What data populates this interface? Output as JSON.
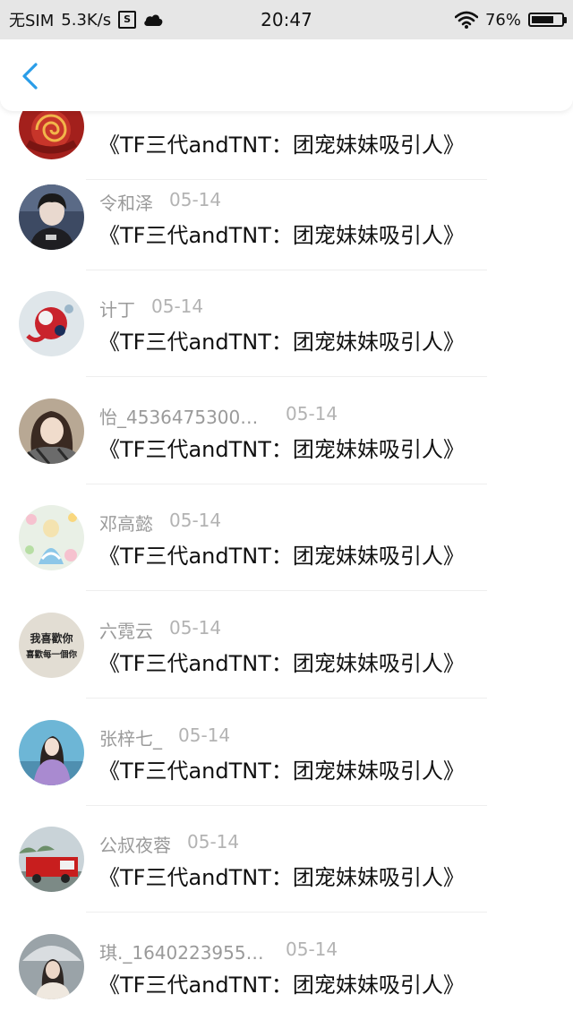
{
  "status_bar": {
    "carrier": "无SIM",
    "speed": "5.3K/s",
    "box_icon_glyph": "S",
    "time": "20:47",
    "battery_percent": "76%",
    "battery_level": 0.76
  },
  "nav": {
    "back_icon": "chevron-left-icon",
    "accent": "#2a9de8"
  },
  "items": [
    {
      "name": "",
      "date": "",
      "message": "《TF三代andTNT：团宠妹妹吸引人》"
    },
    {
      "name": "令和泽",
      "date": "05-14",
      "message": "《TF三代andTNT：团宠妹妹吸引人》"
    },
    {
      "name": "计丁",
      "date": "05-14",
      "message": "《TF三代andTNT：团宠妹妹吸引人》"
    },
    {
      "name": "怡_4536475300…",
      "date": "05-14",
      "message": "《TF三代andTNT：团宠妹妹吸引人》"
    },
    {
      "name": "邓高懿",
      "date": "05-14",
      "message": "《TF三代andTNT：团宠妹妹吸引人》"
    },
    {
      "name": "六霓云",
      "date": "05-14",
      "message": "《TF三代andTNT：团宠妹妹吸引人》",
      "avatar_text": [
        "我喜歡你",
        "喜歡每一個你"
      ]
    },
    {
      "name": "张梓七_",
      "date": "05-14",
      "message": "《TF三代andTNT：团宠妹妹吸引人》"
    },
    {
      "name": "公叔夜蓉",
      "date": "05-14",
      "message": "《TF三代andTNT：团宠妹妹吸引人》"
    },
    {
      "name": "琪._1640223955…",
      "date": "05-14",
      "message": "《TF三代andTNT：团宠妹妹吸引人》"
    }
  ]
}
